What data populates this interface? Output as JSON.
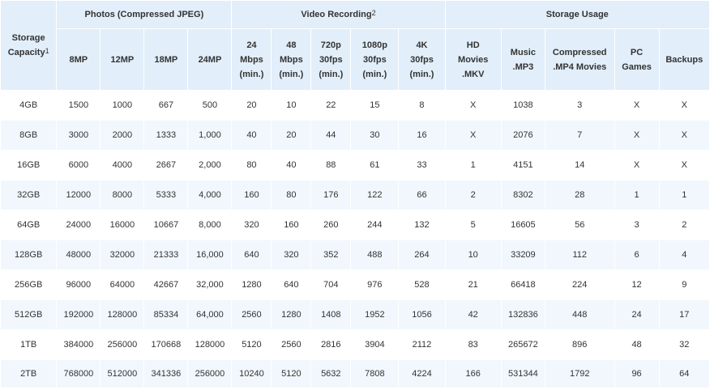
{
  "groups": {
    "storage": "Storage Capacity",
    "storage_sup": "1",
    "photos": "Photos (Compressed JPEG)",
    "video": "Video Recording",
    "video_sup": "2",
    "usage": "Storage Usage"
  },
  "subheaders": {
    "photos": [
      "8MP",
      "12MP",
      "18MP",
      "24MP"
    ],
    "video": [
      [
        "24",
        "Mbps",
        "(min.)"
      ],
      [
        "48",
        "Mbps",
        "(min.)"
      ],
      [
        "720p",
        "30fps",
        "(min.)"
      ],
      [
        "1080p",
        "30fps",
        "(min.)"
      ],
      [
        "4K",
        "30fps",
        "(min.)"
      ]
    ],
    "usage": [
      [
        "HD",
        "Movies",
        ".MKV"
      ],
      [
        "Music",
        ".MP3"
      ],
      [
        "Compressed",
        ".MP4 Movies"
      ],
      [
        "PC",
        "Games"
      ],
      [
        "Backups"
      ]
    ]
  },
  "rows": [
    [
      "4GB",
      "1500",
      "1000",
      "667",
      "500",
      "20",
      "10",
      "22",
      "15",
      "8",
      "X",
      "1038",
      "3",
      "X",
      "X"
    ],
    [
      "8GB",
      "3000",
      "2000",
      "1333",
      "1,000",
      "40",
      "20",
      "44",
      "30",
      "16",
      "X",
      "2076",
      "7",
      "X",
      "X"
    ],
    [
      "16GB",
      "6000",
      "4000",
      "2667",
      "2,000",
      "80",
      "40",
      "88",
      "61",
      "33",
      "1",
      "4151",
      "14",
      "X",
      "X"
    ],
    [
      "32GB",
      "12000",
      "8000",
      "5333",
      "4,000",
      "160",
      "80",
      "176",
      "122",
      "66",
      "2",
      "8302",
      "28",
      "1",
      "1"
    ],
    [
      "64GB",
      "24000",
      "16000",
      "10667",
      "8,000",
      "320",
      "160",
      "260",
      "244",
      "132",
      "5",
      "16605",
      "56",
      "3",
      "2"
    ],
    [
      "128GB",
      "48000",
      "32000",
      "21333",
      "16,000",
      "640",
      "320",
      "352",
      "488",
      "264",
      "10",
      "33209",
      "112",
      "6",
      "4"
    ],
    [
      "256GB",
      "96000",
      "64000",
      "42667",
      "32,000",
      "1280",
      "640",
      "704",
      "976",
      "528",
      "21",
      "66418",
      "224",
      "12",
      "9"
    ],
    [
      "512GB",
      "192000",
      "128000",
      "85334",
      "64,000",
      "2560",
      "1280",
      "1408",
      "1952",
      "1056",
      "42",
      "132836",
      "448",
      "24",
      "17"
    ],
    [
      "1TB",
      "384000",
      "256000",
      "170668",
      "128000",
      "5120",
      "2560",
      "2816",
      "3904",
      "2112",
      "83",
      "265672",
      "896",
      "48",
      "32"
    ],
    [
      "2TB",
      "768000",
      "512000",
      "341336",
      "256000",
      "10240",
      "5120",
      "5632",
      "7808",
      "4224",
      "166",
      "531344",
      "1792",
      "96",
      "64"
    ]
  ]
}
